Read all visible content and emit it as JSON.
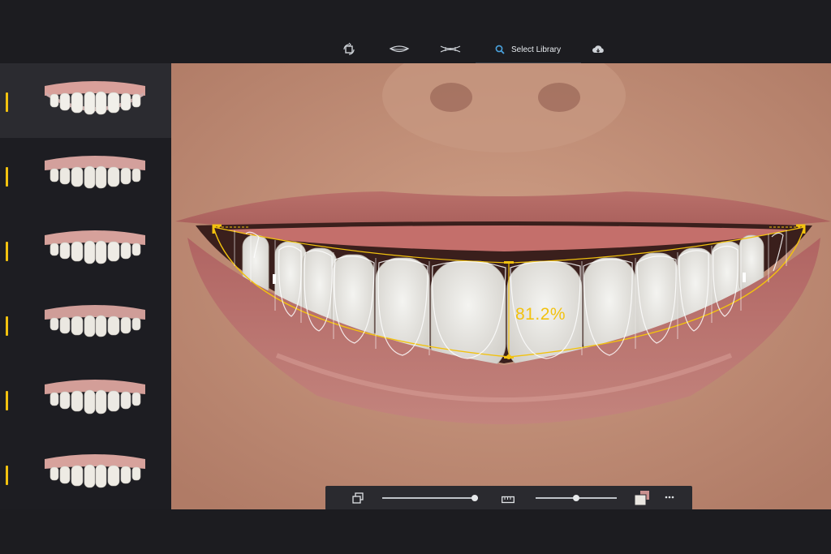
{
  "toolbar": {
    "tools": [
      {
        "name": "rotate-crop-icon"
      },
      {
        "name": "lip-line-icon"
      },
      {
        "name": "smile-curve-icon"
      },
      {
        "name": "search-icon",
        "label": "Select Library",
        "active": true
      },
      {
        "name": "cloud-download-icon"
      }
    ]
  },
  "sidebar": {
    "items": [
      {
        "name": "library-smile-1",
        "selected": true
      },
      {
        "name": "library-smile-2",
        "selected": false
      },
      {
        "name": "library-smile-3",
        "selected": false
      },
      {
        "name": "library-smile-4",
        "selected": false
      },
      {
        "name": "library-smile-5",
        "selected": false
      },
      {
        "name": "library-smile-6",
        "selected": false
      }
    ]
  },
  "overlay": {
    "ratio": "81.2%"
  },
  "bottombar": {
    "opacity_slider_value": 0.97,
    "size_slider_value": 0.5
  },
  "colors": {
    "accent": "#f2c20f",
    "background": "#1c1c20",
    "sidebar_selected": "#2b2b30"
  }
}
